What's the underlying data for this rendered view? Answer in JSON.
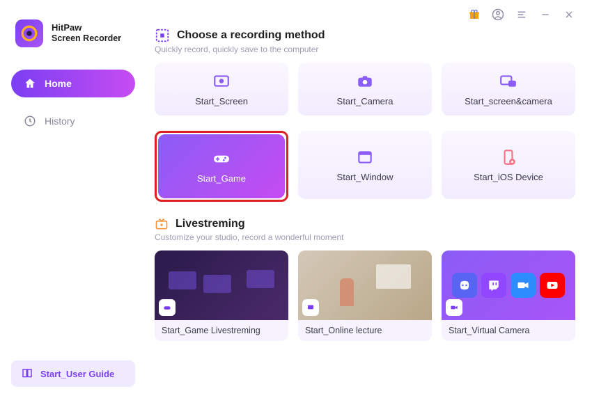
{
  "brand": {
    "name": "HitPaw",
    "subtitle": "Screen Recorder"
  },
  "sidebar": {
    "items": [
      {
        "label": "Home"
      },
      {
        "label": "History"
      }
    ],
    "guide_label": "Start_User Guide"
  },
  "sections": {
    "record": {
      "title": "Choose a recording method",
      "subtitle": "Quickly record, quickly save to the computer",
      "tiles": [
        {
          "label": "Start_Screen"
        },
        {
          "label": "Start_Camera"
        },
        {
          "label": "Start_screen&camera"
        },
        {
          "label": "Start_Game"
        },
        {
          "label": "Start_Window"
        },
        {
          "label": "Start_iOS Device"
        }
      ]
    },
    "live": {
      "title": "Livestreming",
      "subtitle": "Customize your studio, record a wonderful moment",
      "cards": [
        {
          "label": "Start_Game Livestreming"
        },
        {
          "label": "Start_Online lecture"
        },
        {
          "label": "Start_Virtual Camera"
        }
      ]
    }
  }
}
